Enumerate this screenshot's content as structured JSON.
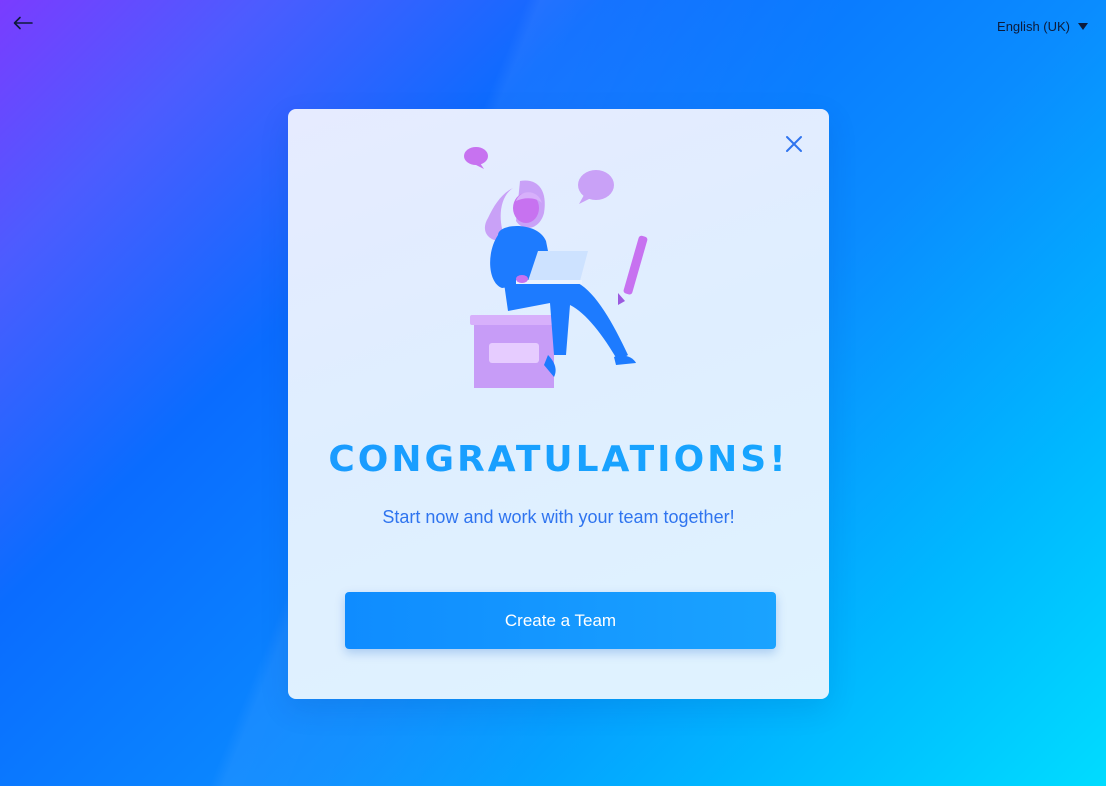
{
  "header": {
    "back_icon": "arrow-left-icon",
    "language_label": "English (UK)",
    "language_icon": "caret-down-icon"
  },
  "modal": {
    "close_icon": "close-icon",
    "illustration": "woman-with-laptop-illustration",
    "title": "CONGRATULATIONS!",
    "subtitle": "Start now and work with your team together!",
    "primary_button_label": "Create a Team"
  },
  "colors": {
    "background_start": "#7a3cff",
    "background_mid": "#0a6cff",
    "background_end": "#00dcff",
    "modal_bg": "#e2eeff",
    "title": "#1aa0ff",
    "subtitle": "#2f74ef",
    "button": "#1297ff",
    "illustration_purple": "#c79cf7",
    "illustration_blue": "#1d7bff"
  }
}
